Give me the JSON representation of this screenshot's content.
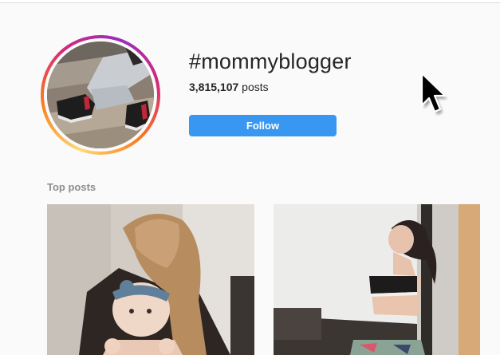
{
  "hashtag": "#mommyblogger",
  "post_count": "3,815,107",
  "post_count_suffix": " posts",
  "follow_label": "Follow",
  "section_title": "Top posts",
  "colors": {
    "follow_button": "#3897f0",
    "page_background": "#fafafa",
    "ring_gradient": [
      "#feda75",
      "#fa7e1e",
      "#d62976",
      "#962fbf"
    ]
  },
  "icons": [
    "mouse-pointer-icon"
  ]
}
